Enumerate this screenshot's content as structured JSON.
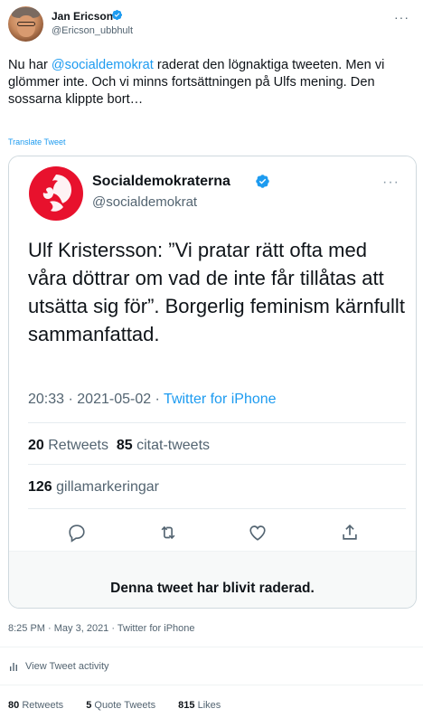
{
  "author": {
    "name": "Jan Ericson",
    "handle": "@Ericson_ubbhult",
    "more_label": "···"
  },
  "tweet": {
    "text_prefix": "Nu har ",
    "mention": "@socialdemokrat",
    "text_suffix": " raderat den lögnaktiga tweeten. Men vi glömmer inte. Och vi minns fortsättningen på Ulfs mening. Den sossarna klippte bort…",
    "translate_label": "Translate Tweet"
  },
  "quoted": {
    "name": "Socialdemokraterna",
    "handle": "@socialdemokrat",
    "more_label": "···",
    "text": "Ulf Kristersson: ”Vi pratar rätt ofta med våra döttrar om vad de inte får tillåtas att utsätta sig för”. Borgerlig feminism kärnfullt sammanfattad.",
    "time": "20:33",
    "date": "2021-05-02",
    "source": "Twitter for iPhone",
    "retweets_count": "20",
    "retweets_label": "Retweets",
    "quotes_count": "85",
    "quotes_label": "citat-tweets",
    "likes_count": "126",
    "likes_label": "gillamarkeringar",
    "deleted_notice": "Denna tweet har blivit raderad."
  },
  "meta": {
    "time": "8:25 PM",
    "date": "May 3, 2021",
    "source": "Twitter for iPhone",
    "separator": "·"
  },
  "activity": {
    "label": "View Tweet activity"
  },
  "stats": {
    "retweets_count": "80",
    "retweets_label": "Retweets",
    "quotes_count": "5",
    "quotes_label": "Quote Tweets",
    "likes_count": "815",
    "likes_label": "Likes"
  },
  "colors": {
    "accent": "#1d9bf0",
    "brand_red": "#e8112d",
    "muted": "#536471"
  }
}
